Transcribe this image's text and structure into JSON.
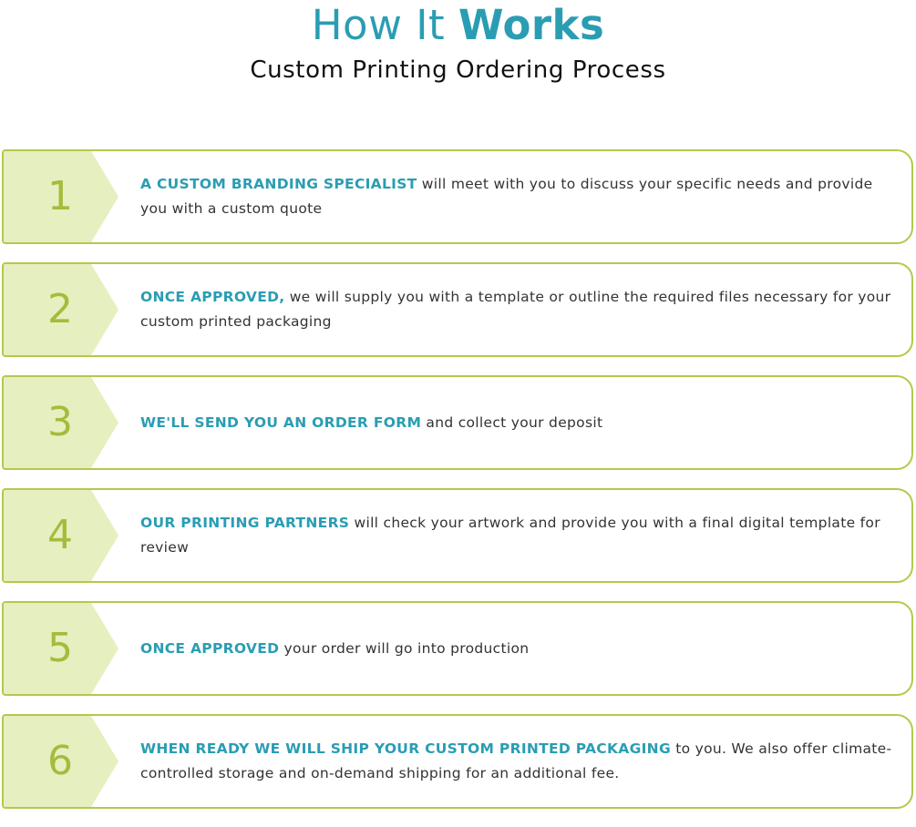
{
  "header": {
    "title_light": "How It ",
    "title_bold": "Works",
    "subtitle": "Custom Printing Ordering Process"
  },
  "colors": {
    "accent_teal": "#2a9db3",
    "accent_green": "#b3c94b",
    "tab_fill": "#e6efbf",
    "number_green": "#a3bc3c"
  },
  "steps": [
    {
      "number": "1",
      "lead": "A CUSTOM BRANDING SPECIALIST",
      "text": " will meet with you to discuss your specific needs and provide you with a custom quote"
    },
    {
      "number": "2",
      "lead": "ONCE APPROVED,",
      "text": " we will supply you with a template or outline the required files necessary for your custom printed packaging"
    },
    {
      "number": "3",
      "lead": "WE'LL SEND YOU AN ORDER FORM",
      "text": " and collect your deposit"
    },
    {
      "number": "4",
      "lead": "OUR PRINTING PARTNERS",
      "text": " will check your artwork and provide you with a final digital template for review"
    },
    {
      "number": "5",
      "lead": "ONCE APPROVED",
      "text": " your order will go into production"
    },
    {
      "number": "6",
      "lead": "WHEN READY WE WILL SHIP YOUR CUSTOM PRINTED PACKAGING",
      "text": " to you. We also offer climate-controlled storage and on-demand shipping for an additional fee."
    }
  ]
}
